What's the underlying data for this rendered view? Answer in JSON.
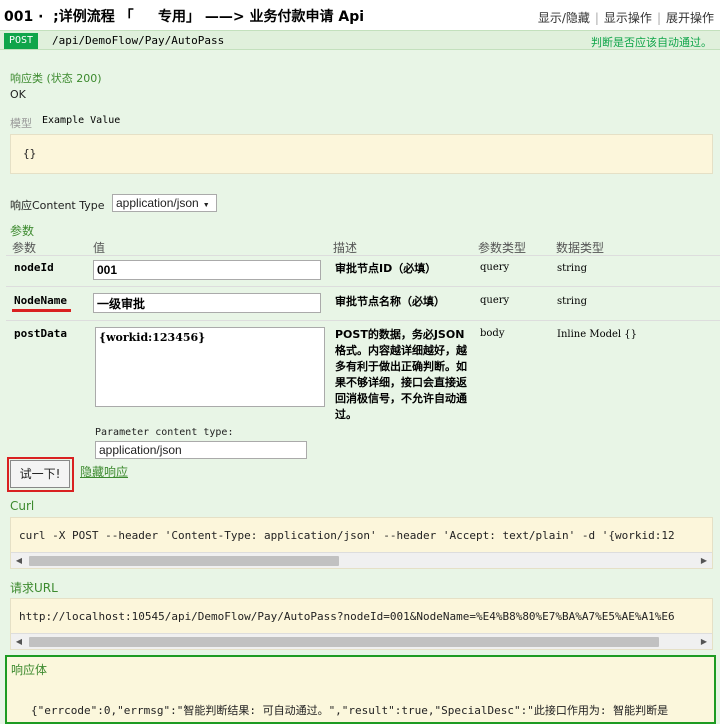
{
  "header": {
    "title": "001 ·  ;详例流程 「     专用」 ——> 业务付款申请 Api",
    "links": [
      "显示/隐藏",
      "显示操作",
      "展开操作"
    ]
  },
  "endpoint": {
    "method": "POST",
    "path": "/api/DemoFlow/Pay/AutoPass",
    "summary": "判断是否应该自动通过。"
  },
  "response_class": {
    "heading": "响应类 (状态 200)",
    "status_text": "OK",
    "model_tab": "模型",
    "example_tab": "Example Value",
    "example_body": "{}"
  },
  "content_type": {
    "label": "响应Content Type",
    "value": "application/json"
  },
  "params": {
    "heading": "参数",
    "columns": [
      "参数",
      "值",
      "描述",
      "参数类型",
      "数据类型"
    ],
    "rows": [
      {
        "name": "nodeId",
        "value": "001",
        "desc": "审批节点ID（必填）",
        "ptype": "query",
        "dtype": "string"
      },
      {
        "name": "NodeName",
        "value": "一级审批",
        "desc": "审批节点名称（必填）",
        "ptype": "query",
        "dtype": "string"
      },
      {
        "name": "postData",
        "value": "{workid:123456}",
        "desc": "POST的数据，务必JSON格式。内容越详细越好，越多有利于做出正确判断。如果不够详细，接口会直接返回消极信号，不允许自动通过。",
        "ptype": "body",
        "dtype": "Inline Model {}"
      }
    ],
    "param_content_type_label": "Parameter content type:",
    "param_content_type_value": "application/json"
  },
  "actions": {
    "try_label": "试一下!",
    "hide_label": "隐藏响应"
  },
  "curl": {
    "heading": "Curl",
    "text": "curl -X POST --header 'Content-Type: application/json' --header 'Accept: text/plain' -d '{workid:12"
  },
  "request_url": {
    "heading": "请求URL",
    "text": "http://localhost:10545/api/DemoFlow/Pay/AutoPass?nodeId=001&NodeName=%E4%B8%80%E7%BA%A7%E5%AE%A1%E6"
  },
  "response_body": {
    "heading": "响应体",
    "text": "{\"errcode\":0,\"errmsg\":\"智能判断结果: 可自动通过。\",\"result\":true,\"SpecialDesc\":\"此接口作用为: 智能判断是"
  },
  "colors": {
    "accent_green": "#10a54a",
    "highlight_red": "#d92121"
  }
}
